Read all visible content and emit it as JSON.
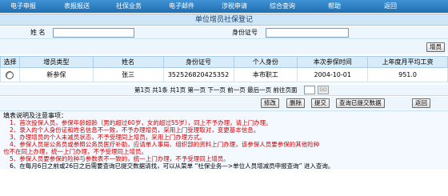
{
  "nav": [
    "电子申报",
    "表报报送",
    "社保业务",
    "电子邮件",
    "涉税申请",
    "综合查询",
    "帮助",
    "返回"
  ],
  "title": "单位增员社保登记",
  "search": {
    "name_label": "姓 名",
    "id_label": "身份证号",
    "name_value": "",
    "id_value": ""
  },
  "add_button": "增员",
  "table": {
    "headers": [
      "选择",
      "增员类型",
      "姓名",
      "身份证号",
      "个人身份",
      "本次参保时间",
      "上年度月平均工资"
    ],
    "rows": [
      [
        "",
        "新参保",
        "张三",
        "352526820425352",
        "本市职工",
        "2004-10-01",
        "951.0"
      ]
    ]
  },
  "pager": {
    "text": "第1页 共1条 共1页 第一页 下一页 前一页 最后一页 前往页面",
    "go_label": "GO"
  },
  "actions": [
    "修改",
    "删除",
    "提交",
    "查询已提交数据",
    "返回"
  ],
  "notes": {
    "title": "填表说明及注意事项：",
    "items": [
      "1、首次投保人员，参保年龄超龄（男的超过60岁，女的超过55岁），同上不予办理，请上门办理。",
      "2、录入的个人身份证和姓名信息不一致，不予办理增员，采用上门受理取对，变更基本信息。",
      "3、办理增员的个人未减员状态，不予受理同上增员，采用上门办理方式。",
      "4、参保人员是公务员或参照公务员医疗补助，应请单人事局、组织部的资料上门办理，该参保人员要参保的其他险种",
      "也不在同上办理，统一上门办理，不予受理同上增员。",
      "5、参保人员要参保的险种与参数表不一致的，统一上门办理，不予受理同上增员。",
      "6、在每月6日之前或26日之后需要查询已提交数据请找，可以从菜单 “社保业务—>单位人员增减员申报查询” 进入查询。"
    ]
  }
}
